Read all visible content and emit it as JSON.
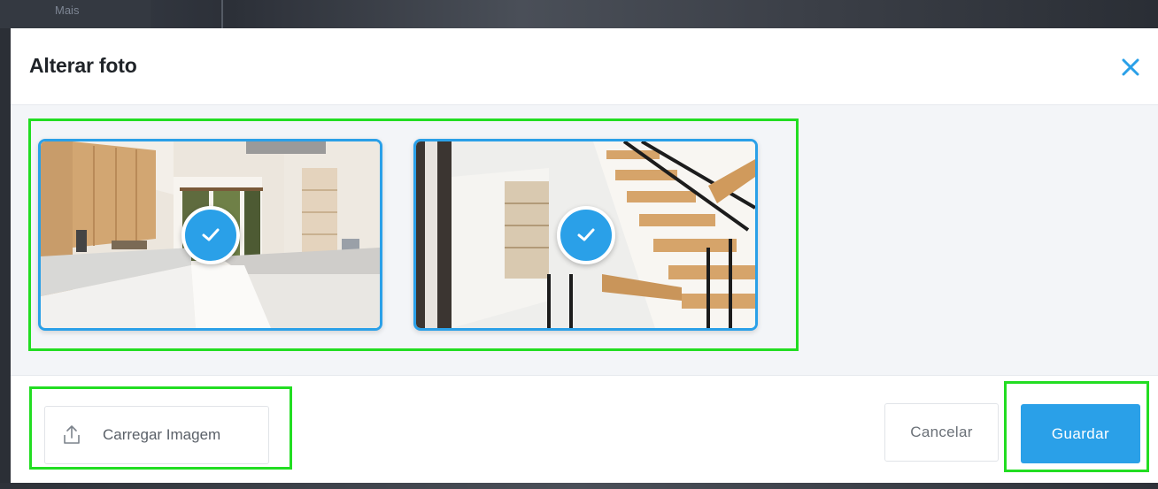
{
  "background": {
    "menu_item_label": "Mais"
  },
  "dialog": {
    "title": "Alterar foto",
    "close_icon": "close-icon"
  },
  "photos": [
    {
      "scene": "kitchen",
      "selected": true,
      "check_icon": "check-icon"
    },
    {
      "scene": "staircase",
      "selected": true,
      "check_icon": "check-icon"
    }
  ],
  "footer": {
    "upload_label": "Carregar Imagem",
    "upload_icon": "upload-icon",
    "cancel_label": "Cancelar",
    "save_label": "Guardar"
  },
  "colors": {
    "accent": "#2aa0e8",
    "highlight_outline": "#22dd22",
    "title_text": "#1f2328"
  }
}
